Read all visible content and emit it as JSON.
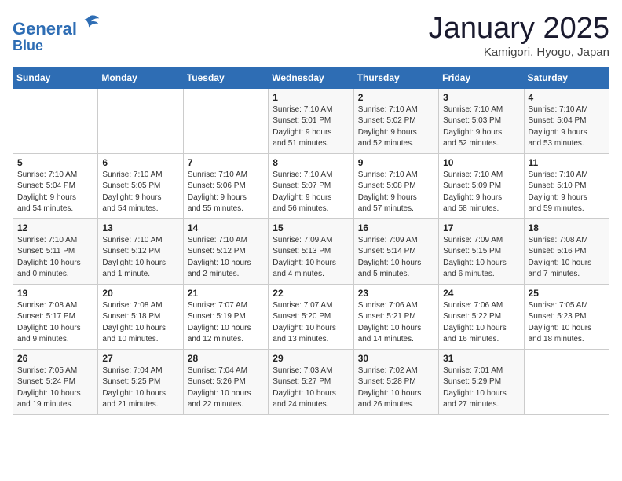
{
  "header": {
    "logo_line1": "General",
    "logo_line2": "Blue",
    "month": "January 2025",
    "location": "Kamigori, Hyogo, Japan"
  },
  "days_of_week": [
    "Sunday",
    "Monday",
    "Tuesday",
    "Wednesday",
    "Thursday",
    "Friday",
    "Saturday"
  ],
  "weeks": [
    [
      {
        "day": "",
        "content": ""
      },
      {
        "day": "",
        "content": ""
      },
      {
        "day": "",
        "content": ""
      },
      {
        "day": "1",
        "content": "Sunrise: 7:10 AM\nSunset: 5:01 PM\nDaylight: 9 hours\nand 51 minutes."
      },
      {
        "day": "2",
        "content": "Sunrise: 7:10 AM\nSunset: 5:02 PM\nDaylight: 9 hours\nand 52 minutes."
      },
      {
        "day": "3",
        "content": "Sunrise: 7:10 AM\nSunset: 5:03 PM\nDaylight: 9 hours\nand 52 minutes."
      },
      {
        "day": "4",
        "content": "Sunrise: 7:10 AM\nSunset: 5:04 PM\nDaylight: 9 hours\nand 53 minutes."
      }
    ],
    [
      {
        "day": "5",
        "content": "Sunrise: 7:10 AM\nSunset: 5:04 PM\nDaylight: 9 hours\nand 54 minutes."
      },
      {
        "day": "6",
        "content": "Sunrise: 7:10 AM\nSunset: 5:05 PM\nDaylight: 9 hours\nand 54 minutes."
      },
      {
        "day": "7",
        "content": "Sunrise: 7:10 AM\nSunset: 5:06 PM\nDaylight: 9 hours\nand 55 minutes."
      },
      {
        "day": "8",
        "content": "Sunrise: 7:10 AM\nSunset: 5:07 PM\nDaylight: 9 hours\nand 56 minutes."
      },
      {
        "day": "9",
        "content": "Sunrise: 7:10 AM\nSunset: 5:08 PM\nDaylight: 9 hours\nand 57 minutes."
      },
      {
        "day": "10",
        "content": "Sunrise: 7:10 AM\nSunset: 5:09 PM\nDaylight: 9 hours\nand 58 minutes."
      },
      {
        "day": "11",
        "content": "Sunrise: 7:10 AM\nSunset: 5:10 PM\nDaylight: 9 hours\nand 59 minutes."
      }
    ],
    [
      {
        "day": "12",
        "content": "Sunrise: 7:10 AM\nSunset: 5:11 PM\nDaylight: 10 hours\nand 0 minutes."
      },
      {
        "day": "13",
        "content": "Sunrise: 7:10 AM\nSunset: 5:12 PM\nDaylight: 10 hours\nand 1 minute."
      },
      {
        "day": "14",
        "content": "Sunrise: 7:10 AM\nSunset: 5:12 PM\nDaylight: 10 hours\nand 2 minutes."
      },
      {
        "day": "15",
        "content": "Sunrise: 7:09 AM\nSunset: 5:13 PM\nDaylight: 10 hours\nand 4 minutes."
      },
      {
        "day": "16",
        "content": "Sunrise: 7:09 AM\nSunset: 5:14 PM\nDaylight: 10 hours\nand 5 minutes."
      },
      {
        "day": "17",
        "content": "Sunrise: 7:09 AM\nSunset: 5:15 PM\nDaylight: 10 hours\nand 6 minutes."
      },
      {
        "day": "18",
        "content": "Sunrise: 7:08 AM\nSunset: 5:16 PM\nDaylight: 10 hours\nand 7 minutes."
      }
    ],
    [
      {
        "day": "19",
        "content": "Sunrise: 7:08 AM\nSunset: 5:17 PM\nDaylight: 10 hours\nand 9 minutes."
      },
      {
        "day": "20",
        "content": "Sunrise: 7:08 AM\nSunset: 5:18 PM\nDaylight: 10 hours\nand 10 minutes."
      },
      {
        "day": "21",
        "content": "Sunrise: 7:07 AM\nSunset: 5:19 PM\nDaylight: 10 hours\nand 12 minutes."
      },
      {
        "day": "22",
        "content": "Sunrise: 7:07 AM\nSunset: 5:20 PM\nDaylight: 10 hours\nand 13 minutes."
      },
      {
        "day": "23",
        "content": "Sunrise: 7:06 AM\nSunset: 5:21 PM\nDaylight: 10 hours\nand 14 minutes."
      },
      {
        "day": "24",
        "content": "Sunrise: 7:06 AM\nSunset: 5:22 PM\nDaylight: 10 hours\nand 16 minutes."
      },
      {
        "day": "25",
        "content": "Sunrise: 7:05 AM\nSunset: 5:23 PM\nDaylight: 10 hours\nand 18 minutes."
      }
    ],
    [
      {
        "day": "26",
        "content": "Sunrise: 7:05 AM\nSunset: 5:24 PM\nDaylight: 10 hours\nand 19 minutes."
      },
      {
        "day": "27",
        "content": "Sunrise: 7:04 AM\nSunset: 5:25 PM\nDaylight: 10 hours\nand 21 minutes."
      },
      {
        "day": "28",
        "content": "Sunrise: 7:04 AM\nSunset: 5:26 PM\nDaylight: 10 hours\nand 22 minutes."
      },
      {
        "day": "29",
        "content": "Sunrise: 7:03 AM\nSunset: 5:27 PM\nDaylight: 10 hours\nand 24 minutes."
      },
      {
        "day": "30",
        "content": "Sunrise: 7:02 AM\nSunset: 5:28 PM\nDaylight: 10 hours\nand 26 minutes."
      },
      {
        "day": "31",
        "content": "Sunrise: 7:01 AM\nSunset: 5:29 PM\nDaylight: 10 hours\nand 27 minutes."
      },
      {
        "day": "",
        "content": ""
      }
    ]
  ]
}
